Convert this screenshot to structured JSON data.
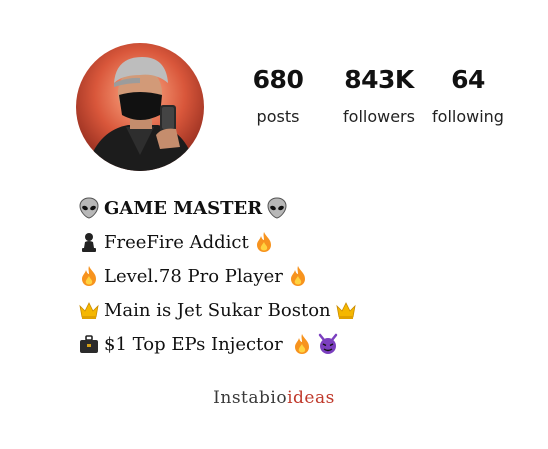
{
  "profile": {
    "stats": [
      {
        "value": "680",
        "label": "posts"
      },
      {
        "value": "843K",
        "label": "followers"
      },
      {
        "value": "64",
        "label": "following"
      }
    ],
    "bio": {
      "title": "GAME MASTER",
      "line1": "FreeFire Addict",
      "line2": "Level.78 Pro Player",
      "line3": "Main is Jet Sukar Boston",
      "line4": "$1 Top EPs Injector"
    }
  },
  "icons": [
    "alien-icon",
    "chess-pawn-icon",
    "fire-icon",
    "crown-icon",
    "briefcase-icon",
    "purple-devil-icon"
  ],
  "colors": {
    "fire": "#f7931e",
    "crown": "#f5b700",
    "devil": "#7b3fbf",
    "brand_accent": "#c0392b"
  },
  "watermark": {
    "part1": "Instabio",
    "part2": "ideas"
  }
}
